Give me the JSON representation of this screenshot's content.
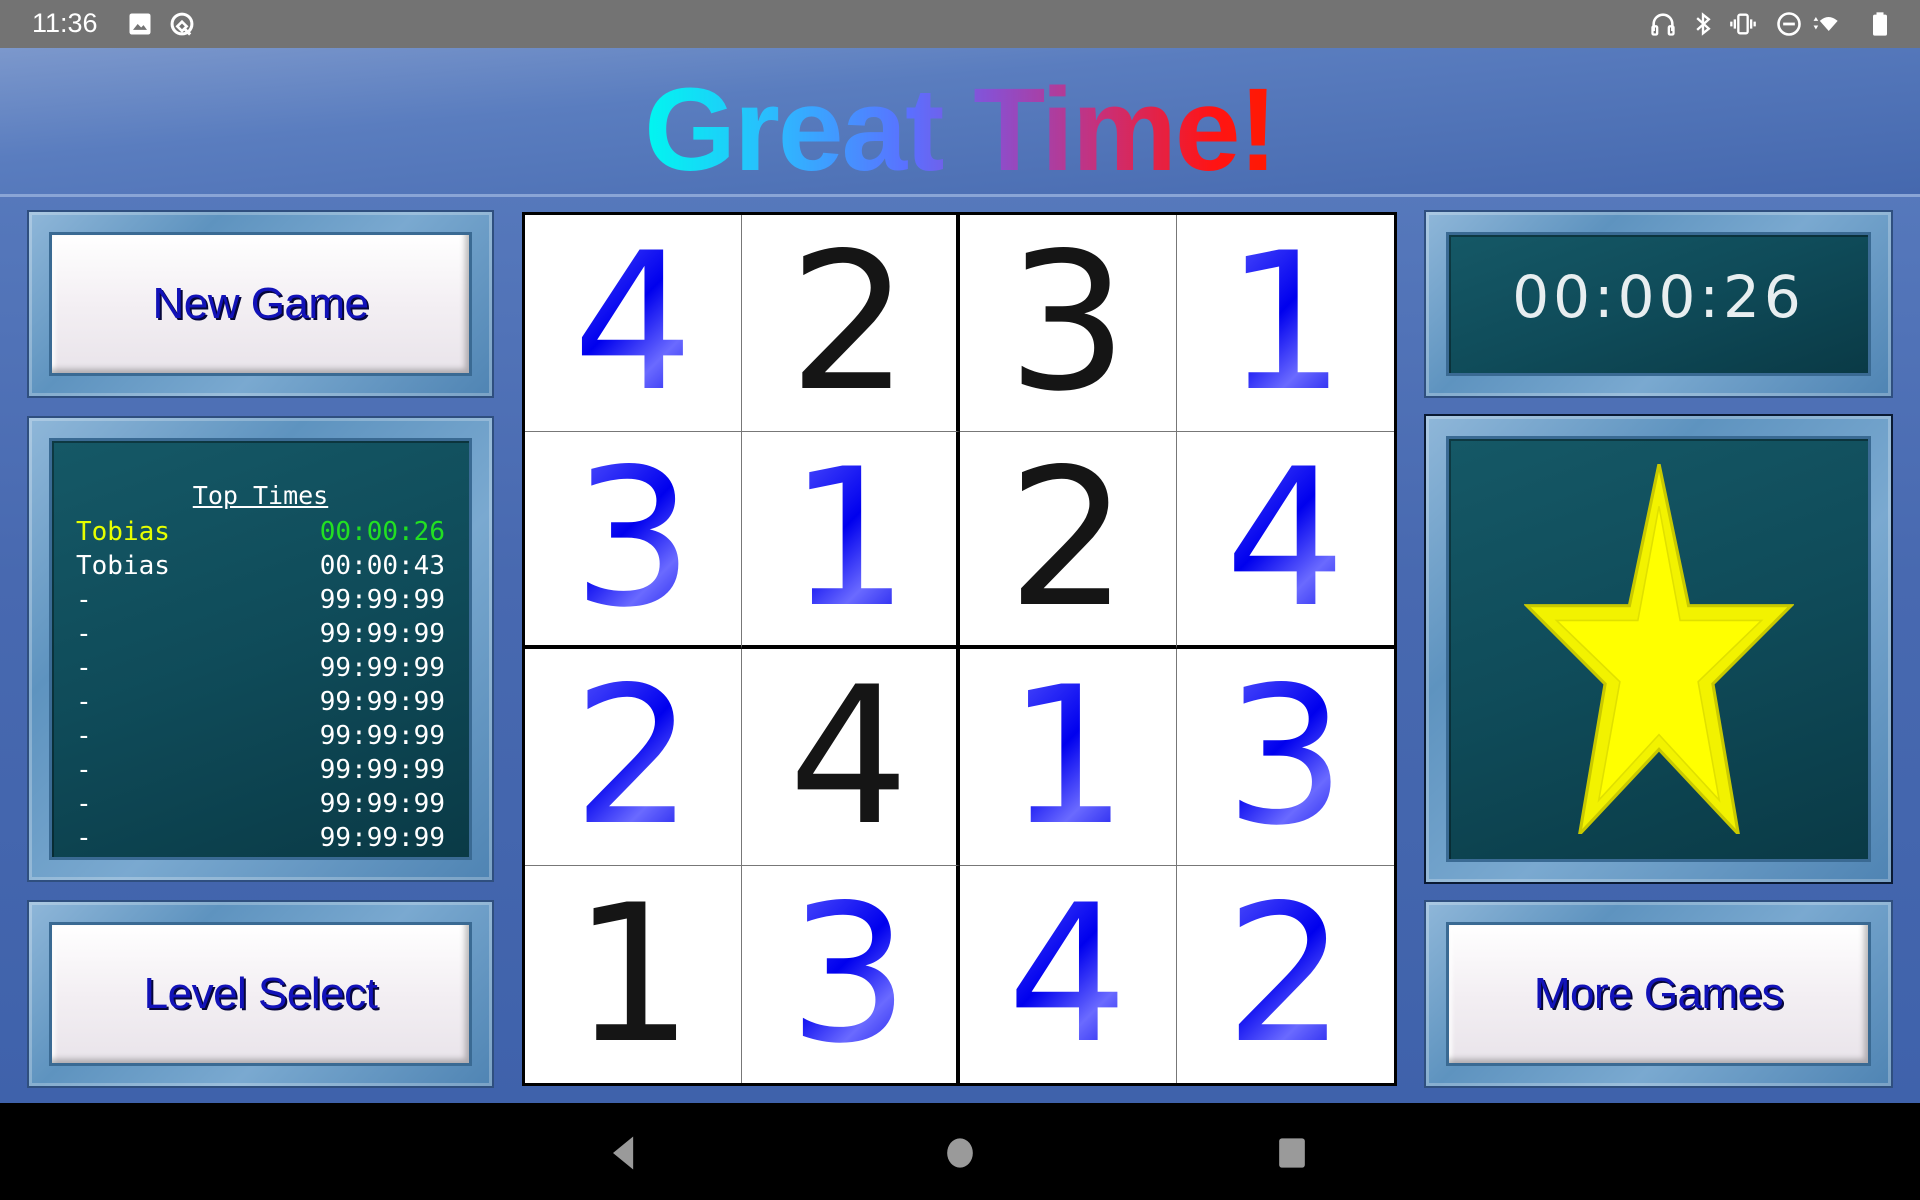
{
  "status_bar": {
    "time": "11:36",
    "left_icons": [
      "image-icon",
      "data-saver-icon"
    ],
    "right_icons": [
      "headphones-icon",
      "bluetooth-icon",
      "vibrate-icon",
      "do-not-disturb-icon",
      "wifi-icon",
      "battery-icon"
    ]
  },
  "header": {
    "title": "Great Time!"
  },
  "buttons": {
    "new_game": "New Game",
    "level_select": "Level Select",
    "more_games": "More Games"
  },
  "top_times": {
    "title": "Top Times",
    "highlight_name_color": "#e6ff00",
    "highlight_time_color": "#22e022",
    "entries": [
      {
        "name": "Tobias",
        "time": "00:00:26",
        "highlight": true
      },
      {
        "name": "Tobias",
        "time": "00:00:43",
        "highlight": false
      },
      {
        "name": "-",
        "time": "99:99:99",
        "highlight": false
      },
      {
        "name": "-",
        "time": "99:99:99",
        "highlight": false
      },
      {
        "name": "-",
        "time": "99:99:99",
        "highlight": false
      },
      {
        "name": "-",
        "time": "99:99:99",
        "highlight": false
      },
      {
        "name": "-",
        "time": "99:99:99",
        "highlight": false
      },
      {
        "name": "-",
        "time": "99:99:99",
        "highlight": false
      },
      {
        "name": "-",
        "time": "99:99:99",
        "highlight": false
      },
      {
        "name": "-",
        "time": "99:99:99",
        "highlight": false
      }
    ]
  },
  "timer": {
    "value": "00:00:26"
  },
  "result": {
    "icon": "star-icon",
    "star_color": "#ffff00"
  },
  "board": {
    "size": 4,
    "cells": [
      [
        {
          "value": "4",
          "given": false
        },
        {
          "value": "2",
          "given": true
        },
        {
          "value": "3",
          "given": true
        },
        {
          "value": "1",
          "given": false
        }
      ],
      [
        {
          "value": "3",
          "given": false
        },
        {
          "value": "1",
          "given": false
        },
        {
          "value": "2",
          "given": true
        },
        {
          "value": "4",
          "given": false
        }
      ],
      [
        {
          "value": "2",
          "given": false
        },
        {
          "value": "4",
          "given": true
        },
        {
          "value": "1",
          "given": false
        },
        {
          "value": "3",
          "given": false
        }
      ],
      [
        {
          "value": "1",
          "given": true
        },
        {
          "value": "3",
          "given": false
        },
        {
          "value": "4",
          "given": false
        },
        {
          "value": "2",
          "given": false
        }
      ]
    ]
  },
  "nav_bar": {
    "buttons": [
      "back",
      "home",
      "recents"
    ]
  }
}
